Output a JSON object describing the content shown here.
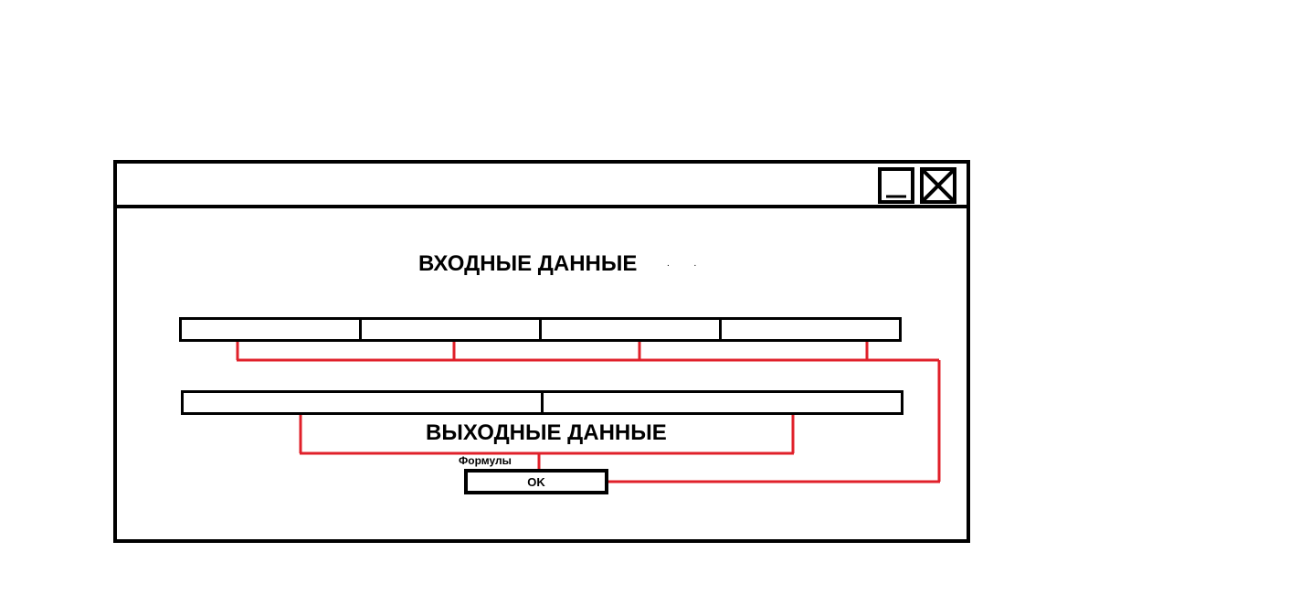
{
  "window": {
    "title": "",
    "controls": {
      "minimize_icon": "minimize-icon",
      "close_icon": "close-icon"
    }
  },
  "input_section": {
    "heading": "ВХОДНЫЕ ДАННЫЕ",
    "dots": ". .",
    "fields": [
      "",
      "",
      "",
      ""
    ]
  },
  "output_section": {
    "heading": "ВЫХОДНЫЕ ДАННЫЕ",
    "fields": [
      "",
      ""
    ]
  },
  "formula_label": "Формулы",
  "ok_button": {
    "label": "OK"
  },
  "colors": {
    "wire": "#e0202a",
    "frame": "#000000",
    "background": "#ffffff"
  }
}
